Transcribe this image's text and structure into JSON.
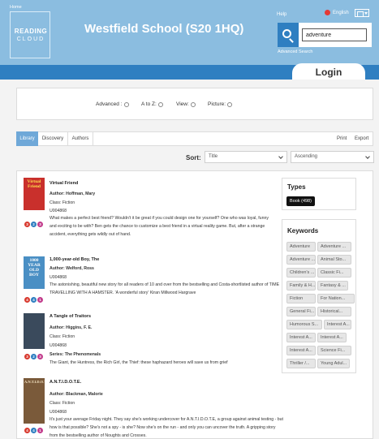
{
  "header": {
    "logo_line1": "READING",
    "logo_line2": "CLOUD",
    "school_title": "Westfield School (S20 1HQ)",
    "help": "Help",
    "language": "English",
    "search_value": "adventure",
    "advanced_search": "Advanced Search"
  },
  "nav": {
    "home": "Home",
    "login": "Login"
  },
  "filters": {
    "advanced": "Advanced :",
    "atoz": "A to Z:",
    "view": "View:",
    "picture": "Picture:"
  },
  "tabs": {
    "library": "Library",
    "discovery": "Discovery",
    "authors": "Authors",
    "print": "Print",
    "export": "Export"
  },
  "sort": {
    "label": "Sort:",
    "field": "Title",
    "order": "Ascending"
  },
  "results": [
    {
      "cover_text": "Virtual Friend",
      "cover_color": "#c9302c",
      "title": "Virtual Friend",
      "author": "Author: Hoffman, Mary",
      "class": "Class: Fiction",
      "id": "U004868",
      "desc": "What makes a perfect best friend? Wouldn't it be great if you could design one for yourself? One who was loyal, funny and exciting to be with? Ben gets the chance to customize a best friend in a virtual reality game. But, after a strange accident, everything gets wildly out of hand.",
      "badges": [
        "3",
        "2",
        "3"
      ]
    },
    {
      "cover_text": "1000 YEAR OLD BOY",
      "cover_color": "#4a8fc4",
      "title": "1,000-year-old Boy, The",
      "author": "Author: Welford, Ross",
      "id": "U004868",
      "desc": "The astonishing, beautiful new story for all readers of 10 and over from the bestselling and Costa-shortlisted author of TIME TRAVELLING WITH A HAMSTER. 'A wonderful story' Kiran Millwood Hargrave",
      "badges": [
        "4",
        "4",
        "1"
      ]
    },
    {
      "cover_text": "",
      "cover_color": "#3a4a5c",
      "title": "A Tangle of Traitors",
      "author": "Author: Higgins, F. E.",
      "class": "Class: Fiction",
      "id": "U004868",
      "series": "Series: The Phenomenals",
      "desc": "The Giant, the Huntress, the Rich Girl, the Thief: these haphazard heroes will save us from grief",
      "badges": [
        "3",
        "2",
        "3"
      ]
    },
    {
      "cover_text": "A.N.T.I.D.O.T.E.",
      "cover_color": "#7a5a3a",
      "title": "A.N.T.I.D.O.T.E.",
      "author": "Author: Blackman, Malorie",
      "class": "Class: Fiction",
      "id": "U004868",
      "desc": "It's just your average Friday night. They say she's working undercover for A.N.T.I.D.O.T.E, a group against animal testing - but how is that possible? She's not a spy - is she? Now she's on the run - and only you can uncover the truth. A gripping story from the bestselling author of Noughts and Crosses.",
      "badges": [
        "4",
        "4",
        "1"
      ]
    }
  ],
  "types": {
    "title": "Types",
    "pill": "Book (498)"
  },
  "keywords": {
    "title": "Keywords",
    "items": [
      "Adventure",
      "Adventure ...",
      "Adventure ...",
      "Animal Sto...",
      "Children's ...",
      "Classic Fi...",
      "Family & H...",
      "Fantasy & ...",
      "Fiction",
      "For Nation...",
      "General Fi...",
      "Historical...",
      "Humorous S...",
      "Interest A...",
      "Interest A...",
      "Interest A...",
      "Interest A...",
      "Science Fi...",
      "Thriller /...",
      "Young Adul..."
    ]
  }
}
